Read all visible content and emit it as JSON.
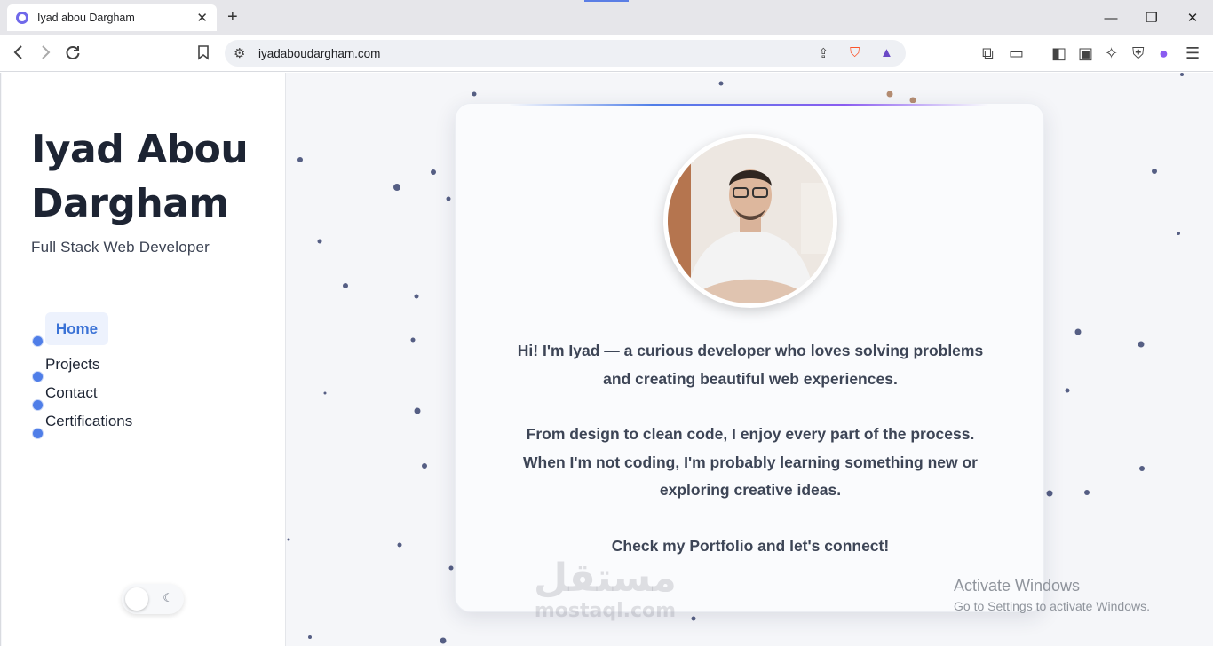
{
  "browser": {
    "tab_title": "Iyad abou Dargham",
    "url": "iyadaboudargham.com"
  },
  "sidebar": {
    "name_line1": "Iyad Abou",
    "name_line2": "Dargham",
    "role": "Full Stack Web Developer",
    "nav": [
      {
        "label": "Home",
        "active": true
      },
      {
        "label": "Projects"
      },
      {
        "label": "Contact"
      },
      {
        "label": "Certifications"
      }
    ]
  },
  "card": {
    "intro_line1": "Hi! I'm Iyad — a curious developer who loves solving problems",
    "intro_line2": "and creating beautiful web experiences.",
    "para2_line1": "From design to clean code, I enjoy every part of the process.",
    "para2_line2": "When I'm not coding, I'm probably learning something new or",
    "para2_line3": "exploring creative ideas.",
    "cta": "Check my Portfolio and let's connect!"
  },
  "watermark": {
    "arabic": "مستقل",
    "latin": "mostaql.com"
  },
  "os_notice": {
    "title": "Activate Windows",
    "subtitle": "Go to Settings to activate Windows."
  },
  "colors": {
    "accent": "#4f7ee8",
    "active_nav_bg": "#edf2fd",
    "heading": "#1d2433"
  },
  "icons": {
    "theme_toggle": "moon-icon",
    "favicon": "site-favicon-icon"
  }
}
